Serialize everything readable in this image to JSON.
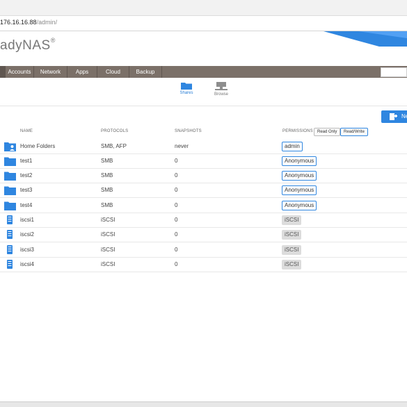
{
  "browser": {
    "url_host": "176.16.16.88",
    "url_path": "/admin/"
  },
  "header": {
    "logo_text": "adyNAS",
    "logo_mark": "®"
  },
  "nav": {
    "items": [
      {
        "label": ""
      },
      {
        "label": "Accounts"
      },
      {
        "label": "Network"
      },
      {
        "label": "Apps"
      },
      {
        "label": "Cloud"
      },
      {
        "label": "Backup"
      }
    ]
  },
  "subtabs": [
    {
      "label": "Shares",
      "icon": "folder-icon",
      "active": true
    },
    {
      "label": "Browse",
      "icon": "browse-icon",
      "active": false
    }
  ],
  "new_button": {
    "label": "Ne",
    "icon": "new-share-icon"
  },
  "table": {
    "headers": {
      "name": "NAME",
      "protocols": "PROTOCOLS",
      "snapshots": "SNAPSHOTS",
      "permissions": "PERMISSIONS"
    },
    "perm_buttons": {
      "read_only": "Read Only",
      "read_write": "Read/Write"
    },
    "rows": [
      {
        "name": "Home Folders",
        "protocols": "SMB, AFP",
        "snapshots": "never",
        "permission": "admin",
        "kind": "home"
      },
      {
        "name": "test1",
        "protocols": "SMB",
        "snapshots": "0",
        "permission": "Anonymous",
        "kind": "folder"
      },
      {
        "name": "test2",
        "protocols": "SMB",
        "snapshots": "0",
        "permission": "Anonymous",
        "kind": "folder"
      },
      {
        "name": "test3",
        "protocols": "SMB",
        "snapshots": "0",
        "permission": "Anonymous",
        "kind": "folder"
      },
      {
        "name": "test4",
        "protocols": "SMB",
        "snapshots": "0",
        "permission": "Anonymous",
        "kind": "folder"
      },
      {
        "name": "iscsi1",
        "protocols": "iSCSI",
        "snapshots": "0",
        "permission": "iSCSI",
        "kind": "lun"
      },
      {
        "name": "iscsi2",
        "protocols": "iSCSI",
        "snapshots": "0",
        "permission": "iSCSI",
        "kind": "lun"
      },
      {
        "name": "iscsi3",
        "protocols": "iSCSI",
        "snapshots": "0",
        "permission": "iSCSI",
        "kind": "lun"
      },
      {
        "name": "iscsi4",
        "protocols": "iSCSI",
        "snapshots": "0",
        "permission": "iSCSI",
        "kind": "lun"
      }
    ]
  },
  "colors": {
    "accent": "#2f86e0",
    "nav_bg": "#7b7068",
    "tag_grey": "#dcdcdc"
  }
}
